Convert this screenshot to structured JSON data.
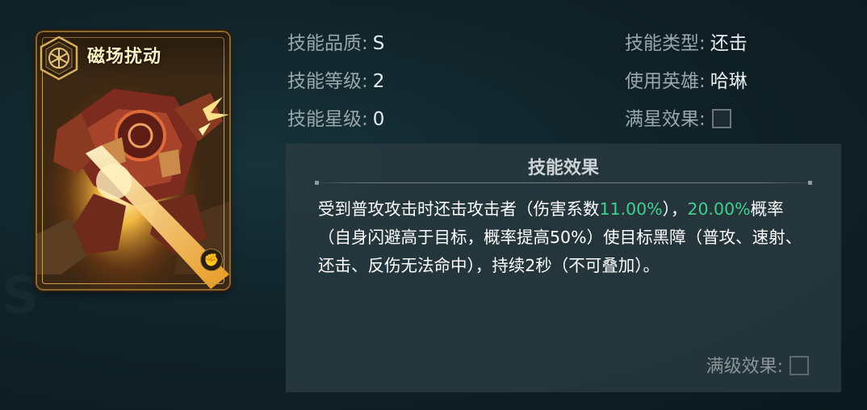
{
  "card": {
    "name": "磁场扰动",
    "emblem_icon": "hexagon-wheel-emblem-icon",
    "type_icon": "fist-icon",
    "type_glyph": "✊"
  },
  "info": {
    "quality_label": "技能品质:",
    "quality_value": "S",
    "level_label": "技能等级:",
    "level_value": "2",
    "star_label": "技能星级:",
    "star_value": "0",
    "type_label": "技能类型:",
    "type_value": "还击",
    "hero_label": "使用英雄:",
    "hero_value": "哈琳",
    "fullstar_label": "满星效果:"
  },
  "effect": {
    "title": "技能效果",
    "text_1": "受到普攻攻击时还击攻击者（伤害系数",
    "hl_1": "11.00%",
    "text_2": "），",
    "hl_2": "20.00%",
    "text_3": "概率（自身闪避高于目标，概率提高50%）使目标黑障（普攻、速射、还击、反伤无法命中），持续2秒（不可叠加）。",
    "maxlevel_label": "满级效果:"
  },
  "colors": {
    "highlight": "#3fcf8e",
    "panel_bg": "#283a40",
    "label": "#9aa7ab",
    "value": "#e8eef0",
    "card_gold": "#c9a04b"
  }
}
